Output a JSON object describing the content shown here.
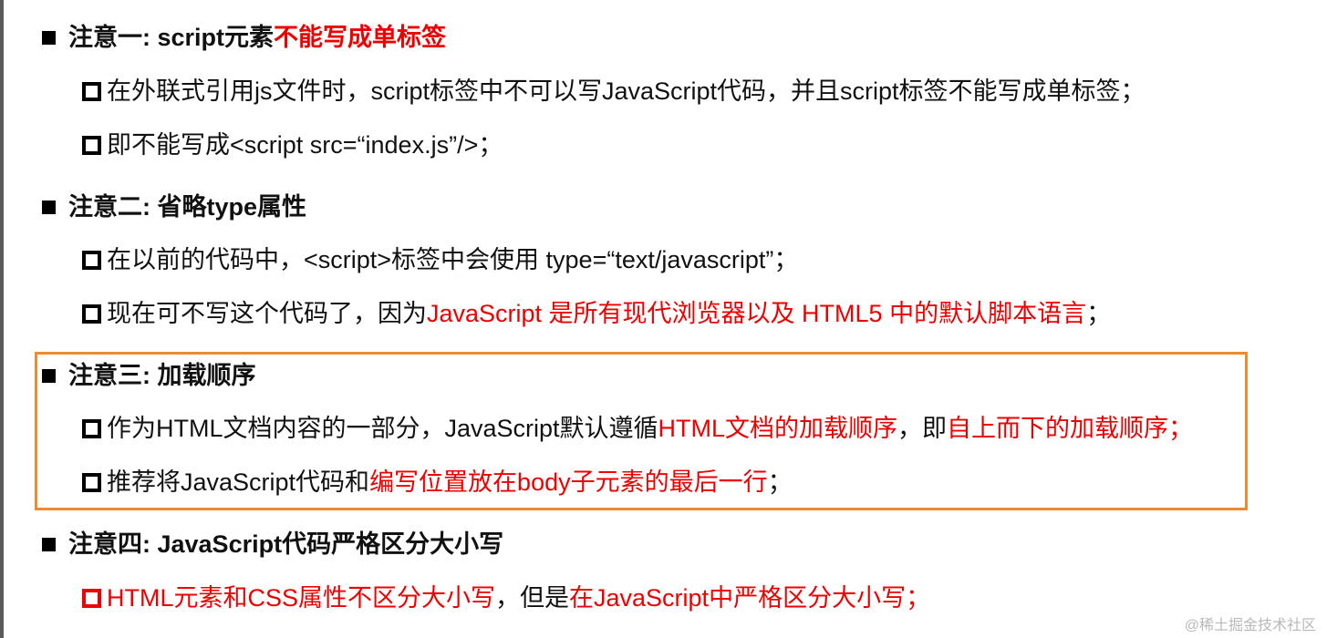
{
  "notes": {
    "n1": {
      "heading": "注意一: script元素",
      "heading_red": "不能写成单标签",
      "sub1": "在外联式引用js文件时，script标签中不可以写JavaScript代码，并且script标签不能写成单标签；",
      "sub2": "即不能写成<script src=“index.js”/>；"
    },
    "n2": {
      "heading": "注意二: 省略type属性",
      "sub1": "在以前的代码中，<script>标签中会使用 type=“text/javascript”；",
      "sub2_a": "现在可不写这个代码了，因为",
      "sub2_red": "JavaScript 是所有现代浏览器以及 HTML5 中的默认脚本语言",
      "sub2_b": "；"
    },
    "n3": {
      "heading": "注意三: 加载顺序",
      "sub1_a": "作为HTML文档内容的一部分，JavaScript默认遵循",
      "sub1_red1": "HTML文档的加载顺序",
      "sub1_b": "，即",
      "sub1_red2": "自上而下的加载顺序；",
      "sub2_a": "推荐将JavaScript代码和",
      "sub2_red": "编写位置放在body子元素的最后一行",
      "sub2_b": "；"
    },
    "n4": {
      "heading": "注意四: JavaScript代码严格区分大小写",
      "sub1_red1": "HTML元素和CSS属性不区分大小写",
      "sub1_b": "，但是",
      "sub1_red2": "在JavaScript中严格区分大小写；"
    }
  },
  "watermark": "@稀土掘金技术社区",
  "colors": {
    "emphasis": "#ee0000",
    "highlight_frame": "#ef8a32"
  }
}
